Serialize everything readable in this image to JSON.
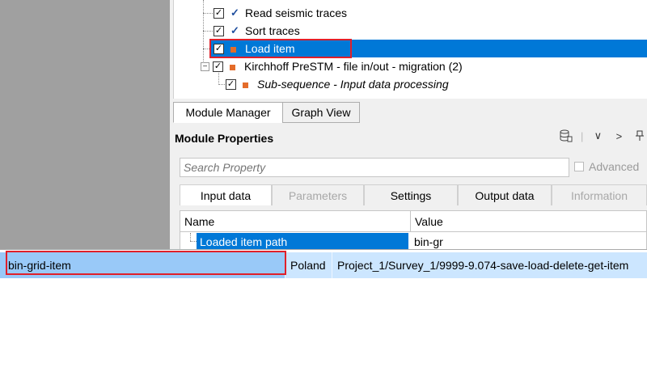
{
  "tree": {
    "items": [
      {
        "label": "Read seismic traces",
        "checked": "✓",
        "mark": "check"
      },
      {
        "label": "Sort traces",
        "checked": "✓",
        "mark": "check"
      },
      {
        "label": "Load item",
        "checked": "✓",
        "mark": "square",
        "selected": true
      },
      {
        "label": "Kirchhoff PreSTM - file in/out - migration (2)",
        "checked": "✓",
        "mark": "square",
        "expander": "−"
      },
      {
        "label": "Sub-sequence - Input data processing",
        "checked": "✓",
        "mark": "square"
      }
    ]
  },
  "tabs": {
    "module_manager": "Module Manager",
    "graph_view": "Graph View"
  },
  "module_properties": {
    "title": "Module Properties",
    "toolbar": {
      "chevron_down": "∨",
      "chevron_right": ">",
      "pin": "⊥",
      "window": "▣"
    },
    "search_placeholder": "Search Property",
    "advanced_label": "Advanced",
    "property_tabs": [
      {
        "label": "Input data",
        "state": "active"
      },
      {
        "label": "Parameters",
        "state": "disabled"
      },
      {
        "label": "Settings",
        "state": "normal"
      },
      {
        "label": "Output data",
        "state": "normal"
      },
      {
        "label": "Information",
        "state": "disabled"
      }
    ],
    "grid": {
      "headers": [
        "Name",
        "Value"
      ],
      "rows": [
        {
          "name": "Loaded item path",
          "value": "bin-gr"
        }
      ]
    }
  },
  "item_list": {
    "rows": [
      {
        "name": "bin-grid-item",
        "location": "Poland",
        "path": "Project_1/Survey_1/9999-9.074-save-load-delete-get-item"
      }
    ]
  },
  "colors": {
    "selection": "#0078d7",
    "highlight_box": "#e0202a",
    "list_selection": "#cce6ff",
    "status_square": "#e46c2a"
  }
}
